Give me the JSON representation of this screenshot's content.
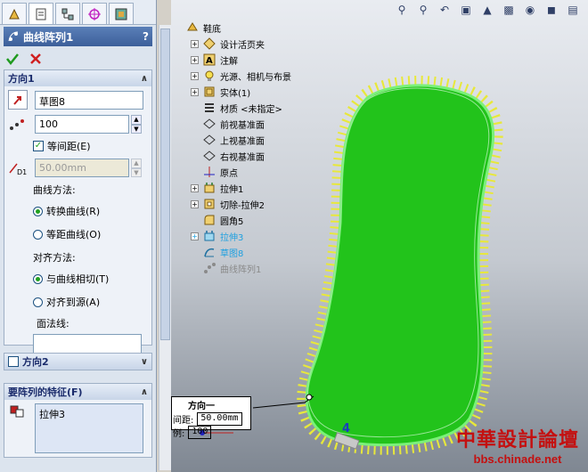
{
  "panel": {
    "title": "曲线阵列1",
    "help": "?",
    "direction1": {
      "header": "方向1",
      "sketch": "草图8",
      "count": "100",
      "equal_spacing_label": "等间距(E)",
      "spacing": "50.00mm",
      "curve_method_label": "曲线方法:",
      "curve_opt1": "转换曲线(R)",
      "curve_opt2": "等距曲线(O)",
      "align_method_label": "对齐方法:",
      "align_opt1": "与曲线相切(T)",
      "align_opt2": "对齐到源(A)",
      "face_normal_label": "面法线:"
    },
    "direction2": {
      "header": "方向2"
    },
    "features": {
      "header": "要阵列的特征(F)",
      "item": "拉伸3"
    }
  },
  "tree": {
    "items": [
      {
        "label": "鞋底"
      },
      {
        "label": "设计活页夹"
      },
      {
        "label": "注解"
      },
      {
        "label": "光源、相机与布景"
      },
      {
        "label": "实体(1)"
      },
      {
        "label": "材质 <未指定>"
      },
      {
        "label": "前视基准面"
      },
      {
        "label": "上视基准面"
      },
      {
        "label": "右视基准面"
      },
      {
        "label": "原点"
      },
      {
        "label": "拉伸1"
      },
      {
        "label": "切除-拉伸2"
      },
      {
        "label": "圆角5"
      },
      {
        "label": "拉伸3"
      },
      {
        "label": "草图8"
      },
      {
        "label": "曲线阵列1"
      }
    ]
  },
  "callout": {
    "title": "方向一",
    "row1_label": "间距:",
    "row1_value": "50.00mm",
    "row2_label": "例:",
    "row2_value": "100"
  },
  "dim_marker": "4",
  "watermark": {
    "line1": "中華設計論壇",
    "line2": "bbs.chinade.net"
  },
  "colors": {
    "shape": "#22c31b",
    "teeth": "#e8e83a",
    "accent": "#2f5fa8"
  }
}
